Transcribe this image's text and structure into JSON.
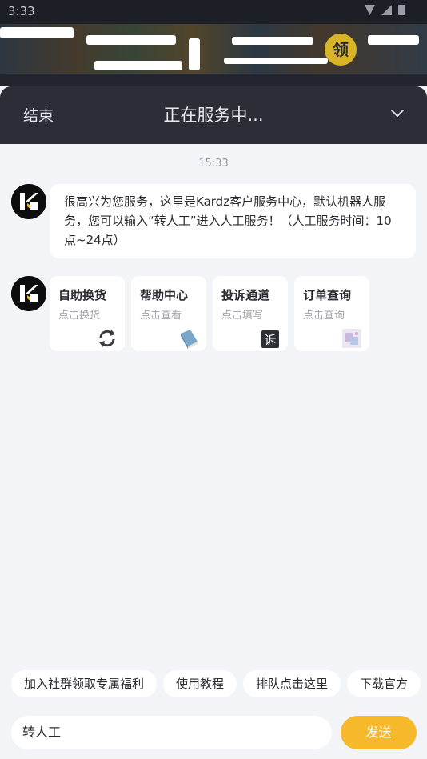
{
  "statusbar": {
    "time": "3:33"
  },
  "banner": {
    "badge_text": "领"
  },
  "header": {
    "end_label": "结束",
    "title": "正在服务中..."
  },
  "chat": {
    "timestamp": "15:33",
    "welcome_message": "很高兴为您服务，这里是Kardz客户服务中心，默认机器人服务，您可以输入“转人工”进入人工服务！（人工服务时间：10点~24点）",
    "cards": [
      {
        "title": "自助换货",
        "subtitle": "点击换货",
        "icon": "refresh-icon"
      },
      {
        "title": "帮助中心",
        "subtitle": "点击查看",
        "icon": "book-icon"
      },
      {
        "title": "投诉通道",
        "subtitle": "点击填写",
        "icon": "complaint-icon",
        "icon_text": "诉"
      },
      {
        "title": "订单查询",
        "subtitle": "点击查询",
        "icon": "order-icon"
      }
    ]
  },
  "chips": [
    "加入社群领取专属福利",
    "使用教程",
    "排队点击这里",
    "下载官方"
  ],
  "input": {
    "value": "转人工"
  },
  "send_label": "发送",
  "colors": {
    "accent": "#f6b92b",
    "header_bg": "#2b2d37",
    "chat_bg": "#f3f4f7"
  }
}
